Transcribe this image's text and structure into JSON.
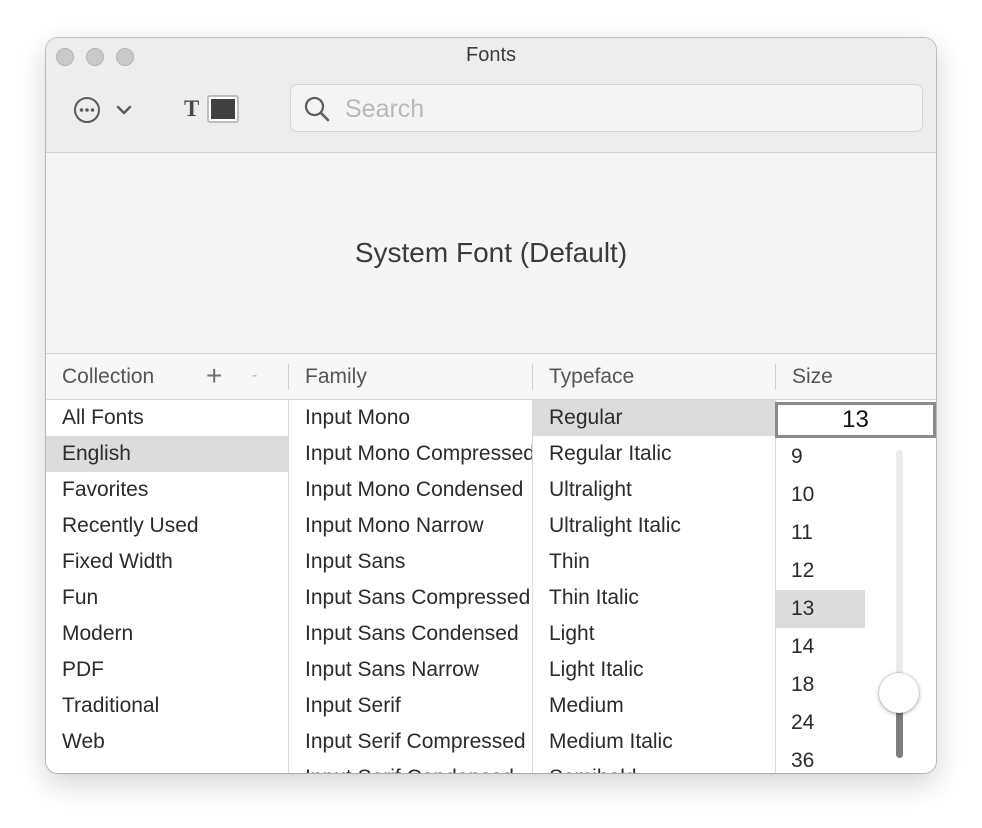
{
  "window": {
    "title": "Fonts"
  },
  "toolbar": {
    "action_icon": "ellipsis-circle-icon",
    "chevron_icon": "chevron-down-icon",
    "text_color_glyph": "T",
    "text_color": "#404040",
    "search_placeholder": "Search",
    "search_value": ""
  },
  "preview": {
    "text": "System Font (Default)"
  },
  "columns": {
    "collection": "Collection",
    "family": "Family",
    "typeface": "Typeface",
    "size": "Size"
  },
  "collection_buttons": {
    "add": "+",
    "remove": "-"
  },
  "collections": {
    "items": [
      "All Fonts",
      "English",
      "Favorites",
      "Recently Used",
      "Fixed Width",
      "Fun",
      "Modern",
      "PDF",
      "Traditional",
      "Web"
    ],
    "selected": "English"
  },
  "families": {
    "items": [
      "Input Mono",
      "Input Mono Compressed",
      "Input Mono Condensed",
      "Input Mono Narrow",
      "Input Sans",
      "Input Sans Compressed",
      "Input Sans Condensed",
      "Input Sans Narrow",
      "Input Serif",
      "Input Serif Compressed",
      "Input Serif Condensed"
    ]
  },
  "typefaces": {
    "items": [
      "Regular",
      "Regular Italic",
      "Ultralight",
      "Ultralight Italic",
      "Thin",
      "Thin Italic",
      "Light",
      "Light Italic",
      "Medium",
      "Medium Italic",
      "Semibold"
    ],
    "selected": "Regular"
  },
  "sizes": {
    "current": "13",
    "items": [
      "9",
      "10",
      "11",
      "12",
      "13",
      "14",
      "18",
      "24",
      "36"
    ],
    "selected": "13",
    "slider_fraction": 0.2
  }
}
